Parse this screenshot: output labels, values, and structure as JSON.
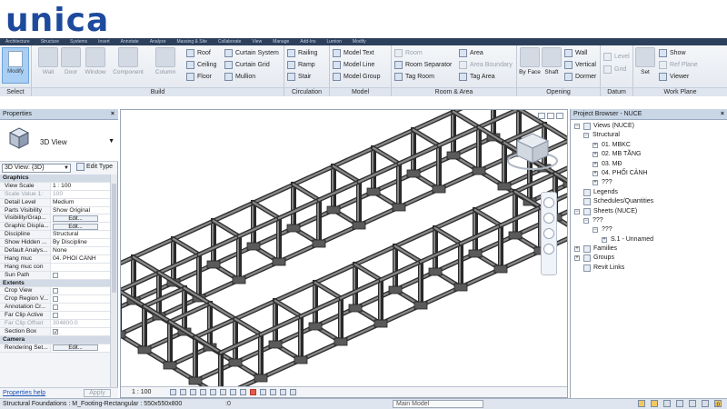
{
  "logo": {
    "text": "unica"
  },
  "ribbon_tabs": [
    "Architecture",
    "Structure",
    "Systems",
    "Insert",
    "Annotate",
    "Analyze",
    "Massing & Site",
    "Collaborate",
    "View",
    "Manage",
    "Add-Ins",
    "Lumion",
    "Modify"
  ],
  "ribbon": {
    "select": {
      "label": "Modify",
      "group": "Select"
    },
    "build": {
      "group": "Build",
      "big": [
        "Wall",
        "Door",
        "Window",
        "Component",
        "Column"
      ],
      "col1": [
        "Roof",
        "Ceiling",
        "Floor"
      ],
      "col2": [
        "Curtain System",
        "Curtain Grid",
        "Mullion"
      ]
    },
    "circulation": {
      "group": "Circulation",
      "items": [
        "Railing",
        "Ramp",
        "Stair"
      ]
    },
    "model": {
      "group": "Model",
      "items": [
        "Model Text",
        "Model Line",
        "Model Group"
      ]
    },
    "room_area": {
      "group": "Room & Area",
      "col1": [
        "Room",
        "Room Separator",
        "Tag Room"
      ],
      "col2": [
        "Area",
        "Area Boundary",
        "Tag Area"
      ]
    },
    "opening": {
      "group": "Opening",
      "big": [
        "By Face",
        "Shaft"
      ],
      "col": [
        "Wall",
        "Vertical",
        "Dormer"
      ]
    },
    "datum": {
      "group": "Datum",
      "items": [
        "Level",
        "Grid"
      ]
    },
    "work_plane": {
      "group": "Work Plane",
      "big": "Set",
      "col": [
        "Show",
        "Ref Plane",
        "Viewer"
      ]
    }
  },
  "properties": {
    "title": "Properties",
    "close": "×",
    "type_name": "3D View",
    "view_selector": "3D View: {3D}",
    "edit_type": "Edit Type",
    "rows": [
      {
        "kind": "section",
        "key": "Graphics"
      },
      {
        "key": "View Scale",
        "value": "1 : 100"
      },
      {
        "key": "Scale Value    1:",
        "value": "100",
        "dim": true
      },
      {
        "key": "Detail Level",
        "value": "Medium"
      },
      {
        "key": "Parts Visibility",
        "value": "Show Original"
      },
      {
        "key": "Visibility/Grap...",
        "button": "Edit..."
      },
      {
        "key": "Graphic Displa...",
        "button": "Edit..."
      },
      {
        "key": "Discipline",
        "value": "Structural"
      },
      {
        "key": "Show Hidden ...",
        "value": "By Discipline"
      },
      {
        "key": "Default Analys...",
        "value": "None"
      },
      {
        "key": "Hang muc",
        "value": "04. PHỐI CẢNH"
      },
      {
        "key": "Hang muc con",
        "value": ""
      },
      {
        "key": "Sun Path",
        "checkbox": false
      },
      {
        "kind": "section",
        "key": "Extents"
      },
      {
        "key": "Crop View",
        "checkbox": false
      },
      {
        "key": "Crop Region V...",
        "checkbox": false
      },
      {
        "key": "Annotation Cr...",
        "checkbox": false
      },
      {
        "key": "Far Clip Active",
        "checkbox": false
      },
      {
        "key": "Far Clip Offset",
        "value": "304800.0",
        "dim": true
      },
      {
        "key": "Section Box",
        "checkbox": true
      },
      {
        "kind": "section",
        "key": "Camera"
      },
      {
        "key": "Rendering Set...",
        "button": "Edit..."
      }
    ],
    "help": "Properties help",
    "apply": "Apply"
  },
  "viewport": {
    "scale": "1 : 100"
  },
  "browser": {
    "title": "Project Browser - NUCE",
    "close": "×",
    "nodes": [
      {
        "level": 0,
        "toggle": "−",
        "icon": true,
        "label": "Views (NUCE)"
      },
      {
        "level": 1,
        "toggle": "−",
        "icon": false,
        "label": "Structural"
      },
      {
        "level": 2,
        "toggle": "+",
        "icon": false,
        "label": "01. MBKC"
      },
      {
        "level": 2,
        "toggle": "+",
        "icon": false,
        "label": "02. MB TẦNG"
      },
      {
        "level": 2,
        "toggle": "+",
        "icon": false,
        "label": "03. MĐ"
      },
      {
        "level": 2,
        "toggle": "+",
        "icon": false,
        "label": "04. PHỐI CẢNH"
      },
      {
        "level": 2,
        "toggle": "+",
        "icon": false,
        "label": "???"
      },
      {
        "level": 0,
        "toggle": "",
        "icon": true,
        "label": "Legends"
      },
      {
        "level": 0,
        "toggle": "",
        "icon": true,
        "label": "Schedules/Quantities"
      },
      {
        "level": 0,
        "toggle": "−",
        "icon": true,
        "label": "Sheets (NUCE)"
      },
      {
        "level": 1,
        "toggle": "−",
        "icon": false,
        "label": "???"
      },
      {
        "level": 2,
        "toggle": "−",
        "icon": false,
        "label": "???"
      },
      {
        "level": 3,
        "toggle": "+",
        "icon": false,
        "label": "S.1 - Unnamed"
      },
      {
        "level": 0,
        "toggle": "+",
        "icon": true,
        "label": "Families"
      },
      {
        "level": 0,
        "toggle": "+",
        "icon": true,
        "label": "Groups"
      },
      {
        "level": 0,
        "toggle": "",
        "icon": true,
        "label": "Revit Links"
      }
    ]
  },
  "statusbar": {
    "message": "Structural Foundations : M_Footing-Rectangular : 550x550x800",
    "count": ":0",
    "model": "Main Model",
    "filter_count": ":0"
  },
  "colors": {
    "accent": "#1d4a9c",
    "ribbon_dark": "#2c3f5b",
    "panel_head": "#c9d6e6",
    "structure": "#3a3a3a"
  }
}
